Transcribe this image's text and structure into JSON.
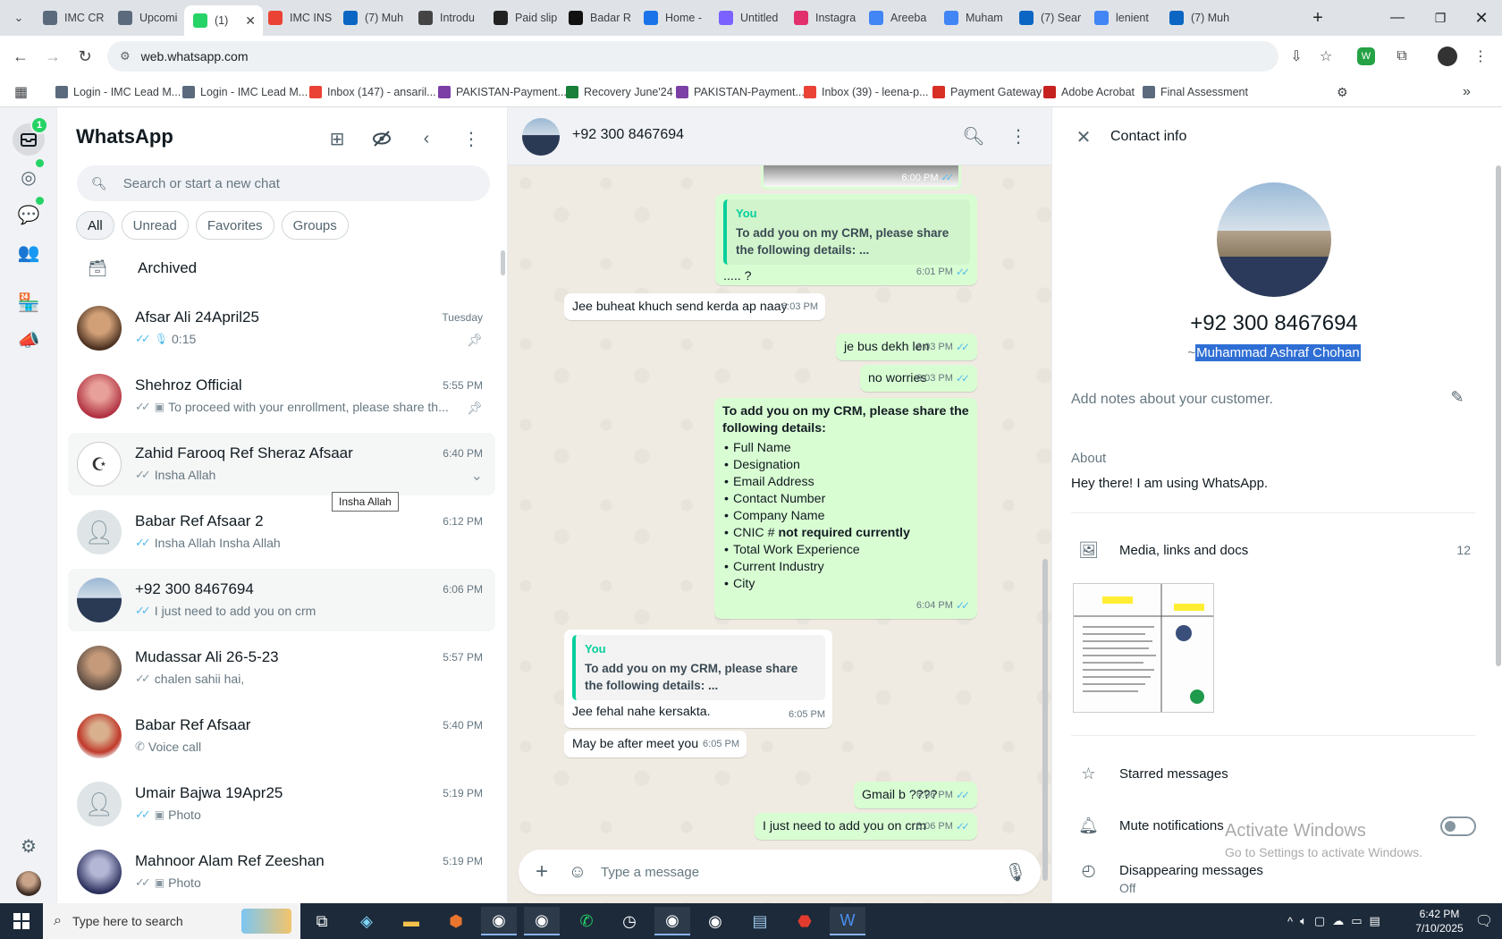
{
  "browser": {
    "tabs": [
      {
        "label": "IMC CR",
        "favicon_color": "#5b6b7d"
      },
      {
        "label": "Upcomi",
        "favicon_color": "#5b6b7d"
      },
      {
        "label": "(1)",
        "favicon_color": "#25d366"
      },
      {
        "label": "IMC INS",
        "favicon_color": "#ea4335"
      },
      {
        "label": "(7) Muh",
        "favicon_color": "#0a66c2"
      },
      {
        "label": "Introdu",
        "favicon_color": "#444444"
      },
      {
        "label": "Paid slip",
        "favicon_color": "#222222"
      },
      {
        "label": "Badar R",
        "favicon_color": "#111111"
      },
      {
        "label": "Home -",
        "favicon_color": "#1a73e8"
      },
      {
        "label": "Untitled",
        "favicon_color": "#7b61ff"
      },
      {
        "label": "Instagra",
        "favicon_color": "#e1306c"
      },
      {
        "label": "Areeba",
        "favicon_color": "#4285f4"
      },
      {
        "label": "Muham",
        "favicon_color": "#4285f4"
      },
      {
        "label": "(7) Sear",
        "favicon_color": "#0a66c2"
      },
      {
        "label": "lenient",
        "favicon_color": "#4285f4"
      },
      {
        "label": "(7) Muh",
        "favicon_color": "#0a66c2"
      }
    ],
    "url": "web.whatsapp.com",
    "bookmarks": [
      {
        "label": "Login - IMC Lead M...",
        "color": "#5b6b7d"
      },
      {
        "label": "Login - IMC Lead M...",
        "color": "#5b6b7d"
      },
      {
        "label": "Inbox (147) - ansaril...",
        "color": "#ea4335"
      },
      {
        "label": "PAKISTAN-Payment...",
        "color": "#7b3fa6"
      },
      {
        "label": "Recovery June'24",
        "color": "#188038"
      },
      {
        "label": "PAKISTAN-Payment...",
        "color": "#7b3fa6"
      },
      {
        "label": "Inbox (39) - leena-p...",
        "color": "#ea4335"
      },
      {
        "label": "Payment Gateway",
        "color": "#d93025"
      },
      {
        "label": "Adobe Acrobat",
        "color": "#c5221f"
      },
      {
        "label": "Final Assessment",
        "color": "#5b6b7d"
      }
    ]
  },
  "whatsapp": {
    "rail_badge": "1",
    "app_title": "WhatsApp",
    "search_placeholder": "Search or start a new chat",
    "filters": [
      "All",
      "Unread",
      "Favorites",
      "Groups"
    ],
    "archived_label": "Archived",
    "chats": [
      {
        "name": "Afsar Ali 24April25",
        "time": "Tuesday",
        "tick": "blue",
        "prefix_icon": "mic",
        "preview": "0:15",
        "pinned": true
      },
      {
        "name": "Shehroz Official",
        "time": "5:55 PM",
        "tick": "grey",
        "prefix_icon": "image",
        "preview": "To proceed with your enrollment, please share th...",
        "pinned": true
      },
      {
        "name": "Zahid Farooq Ref Sheraz Afsaar",
        "time": "6:40 PM",
        "tick": "grey",
        "prefix_icon": "",
        "preview": "Insha Allah",
        "pinned": false
      },
      {
        "name": "Babar Ref Afsaar 2",
        "time": "6:12 PM",
        "tick": "blue",
        "prefix_icon": "",
        "preview": "Insha Allah  Insha Allah",
        "pinned": false
      },
      {
        "name": "+92 300 8467694",
        "time": "6:06 PM",
        "tick": "blue",
        "prefix_icon": "",
        "preview": "I just need to add you on crm",
        "pinned": false
      },
      {
        "name": "Mudassar Ali 26-5-23",
        "time": "5:57 PM",
        "tick": "grey",
        "prefix_icon": "",
        "preview": "chalen sahii hai,",
        "pinned": false
      },
      {
        "name": "Babar Ref Afsaar",
        "time": "5:40 PM",
        "tick": "none",
        "prefix_icon": "phone",
        "preview": "Voice call",
        "pinned": false
      },
      {
        "name": "Umair Bajwa 19Apr25",
        "time": "5:19 PM",
        "tick": "blue",
        "prefix_icon": "image",
        "preview": "Photo",
        "pinned": false
      },
      {
        "name": "Mahnoor Alam Ref Zeeshan",
        "time": "5:19 PM",
        "tick": "grey",
        "prefix_icon": "image",
        "preview": "Photo",
        "pinned": false
      }
    ],
    "tooltip": "Insha Allah",
    "conversation": {
      "title": "+92 300 8467694",
      "image_time": "6:00 PM",
      "messages": [
        {
          "dir": "out",
          "quote_author": "You",
          "quote_text": "To add you on my CRM, please share the following details: ...",
          "text": "..... ?",
          "time": "6:01 PM"
        },
        {
          "dir": "in",
          "text": "Jee buheat khuch send kerda ap naay",
          "time": "6:03 PM"
        },
        {
          "dir": "out",
          "text": "je bus dekh len",
          "time": "6:03 PM"
        },
        {
          "dir": "out",
          "text": "no worries",
          "time": "6:03 PM"
        },
        {
          "dir": "out",
          "heading": "To add you on my CRM, please share the following details:",
          "items": [
            "Full Name",
            "Designation",
            "Email Address",
            "Contact Number",
            "Company Name",
            "CNIC # ",
            "Total Work Experience",
            "Current Industry",
            "City"
          ],
          "cnic_bold": "not required currently",
          "time": "6:04 PM"
        },
        {
          "dir": "in",
          "quote_author": "You",
          "quote_text": "To add you on my CRM, please share the following details: ...",
          "text": "Jee fehal nahe kersakta.",
          "time": "6:05 PM"
        },
        {
          "dir": "in",
          "text": "May be after meet you",
          "time": "6:05 PM"
        },
        {
          "dir": "out",
          "text": "Gmail b ????",
          "time": "6:06 PM"
        },
        {
          "dir": "out",
          "text": "I just need to add you on crm",
          "time": "6:06 PM"
        }
      ],
      "composer_placeholder": "Type a message"
    },
    "contact_info": {
      "title": "Contact info",
      "phone": "+92 300 8467694",
      "name_prefix": "~",
      "name": "Muhammad Ashraf Chohan",
      "notes_placeholder": "Add notes about your customer.",
      "about_label": "About",
      "about_text": "Hey there! I am using WhatsApp.",
      "media_label": "Media, links and docs",
      "media_count": "12",
      "starred_label": "Starred messages",
      "mute_label": "Mute notifications",
      "disappearing_label": "Disappearing messages",
      "disappearing_value": "Off"
    }
  },
  "activate_windows": {
    "line1": "Activate Windows",
    "line2": "Go to Settings to activate Windows."
  },
  "taskbar": {
    "search_placeholder": "Type here to search",
    "time": "6:42 PM",
    "date": "7/10/2025"
  }
}
